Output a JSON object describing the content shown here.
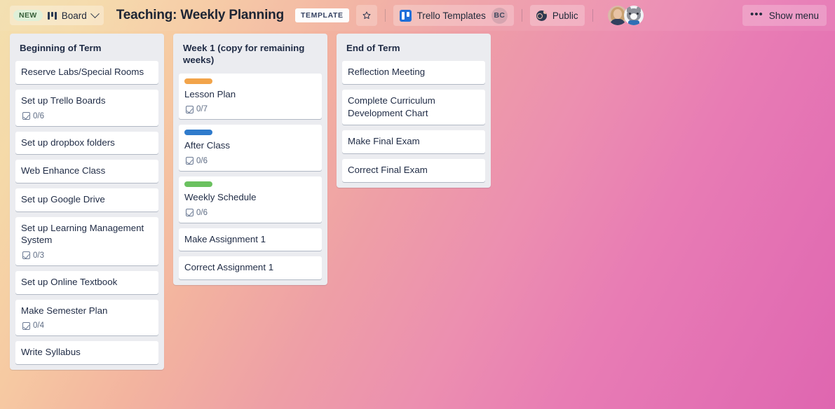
{
  "header": {
    "new_badge": "NEW",
    "board_switcher_label": "Board",
    "board_title": "Teaching: Weekly Planning",
    "template_badge": "TEMPLATE",
    "star_icon": "star-outline-icon",
    "workspace_name": "Trello Templates",
    "workspace_initials": "BC",
    "visibility_label": "Public",
    "visibility_icon": "globe-icon",
    "members": [
      {
        "name": "member-avatar-photo"
      },
      {
        "name": "member-avatar-husky"
      }
    ],
    "show_menu_label": "Show menu",
    "show_menu_dots": "•••"
  },
  "colors": {
    "label_orange": "#f2a44a",
    "label_blue": "#2f7bcc",
    "label_green": "#6bc160",
    "list_background": "#ebecf0",
    "card_background": "#ffffff",
    "text_dark": "#1f2b45",
    "badge_text": "#5e6c84",
    "trello_blue": "#1e6fd9",
    "new_badge_green": "#dff0d8"
  },
  "lists": [
    {
      "title": "Beginning of Term",
      "cards": [
        {
          "title": "Reserve Labs/Special Rooms",
          "label": null,
          "checklist": null
        },
        {
          "title": "Set up Trello Boards",
          "label": null,
          "checklist": "0/6"
        },
        {
          "title": "Set up dropbox folders",
          "label": null,
          "checklist": null
        },
        {
          "title": "Web Enhance Class",
          "label": null,
          "checklist": null
        },
        {
          "title": "Set up Google Drive",
          "label": null,
          "checklist": null
        },
        {
          "title": "Set up Learning Management System",
          "label": null,
          "checklist": "0/3"
        },
        {
          "title": "Set up Online Textbook",
          "label": null,
          "checklist": null
        },
        {
          "title": "Make Semester Plan",
          "label": null,
          "checklist": "0/4"
        },
        {
          "title": "Write Syllabus",
          "label": null,
          "checklist": null
        }
      ]
    },
    {
      "title": "Week 1 (copy for remaining weeks)",
      "cards": [
        {
          "title": "Lesson Plan",
          "label": "#f2a44a",
          "checklist": "0/7"
        },
        {
          "title": "After Class",
          "label": "#2f7bcc",
          "checklist": "0/6"
        },
        {
          "title": "Weekly Schedule",
          "label": "#6bc160",
          "checklist": "0/6"
        },
        {
          "title": "Make Assignment 1",
          "label": null,
          "checklist": null
        },
        {
          "title": "Correct Assignment 1",
          "label": null,
          "checklist": null
        }
      ]
    },
    {
      "title": "End of Term",
      "cards": [
        {
          "title": "Reflection Meeting",
          "label": null,
          "checklist": null
        },
        {
          "title": "Complete Curriculum Development Chart",
          "label": null,
          "checklist": null
        },
        {
          "title": "Make Final Exam",
          "label": null,
          "checklist": null
        },
        {
          "title": "Correct Final Exam",
          "label": null,
          "checklist": null
        }
      ]
    }
  ]
}
